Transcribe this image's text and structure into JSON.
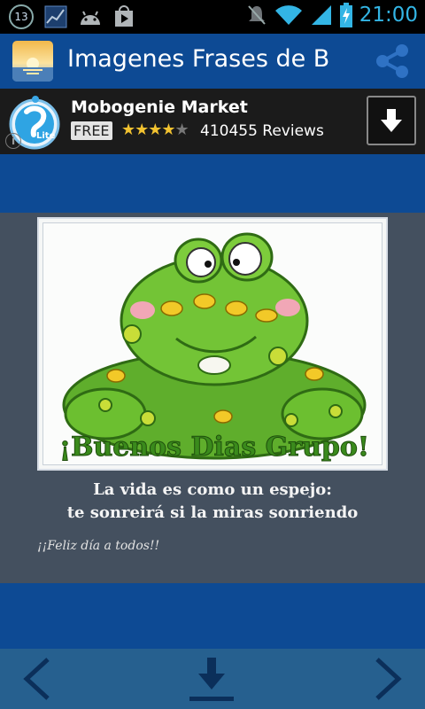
{
  "status_bar": {
    "notification_count": "13",
    "time": "21:00",
    "icons": [
      "chart-icon",
      "android-icon",
      "play-store-icon",
      "mute-icon",
      "wifi-icon",
      "signal-icon",
      "battery-charging-icon"
    ]
  },
  "action_bar": {
    "title": "Imagenes Frases de B",
    "app_icon": "sunset-icon",
    "share_icon": "share-icon"
  },
  "ad": {
    "title": "Mobogenie Market",
    "free_label": "FREE",
    "rating": 4,
    "stars_on": "★★★★",
    "stars_off": "★",
    "reviews": "410455 Reviews",
    "badge": "Lite"
  },
  "image": {
    "headline": "¡Buenos Dias Grupo!"
  },
  "caption": {
    "line1": "La vida es como un espejo:",
    "line2": "te sonreirá si la miras sonriendo",
    "signature": "¡¡Feliz día a todos!!"
  },
  "colors": {
    "primary": "#0d4a94",
    "card": "#44505f",
    "nav": "#26608f",
    "accent": "#33b5e5"
  }
}
